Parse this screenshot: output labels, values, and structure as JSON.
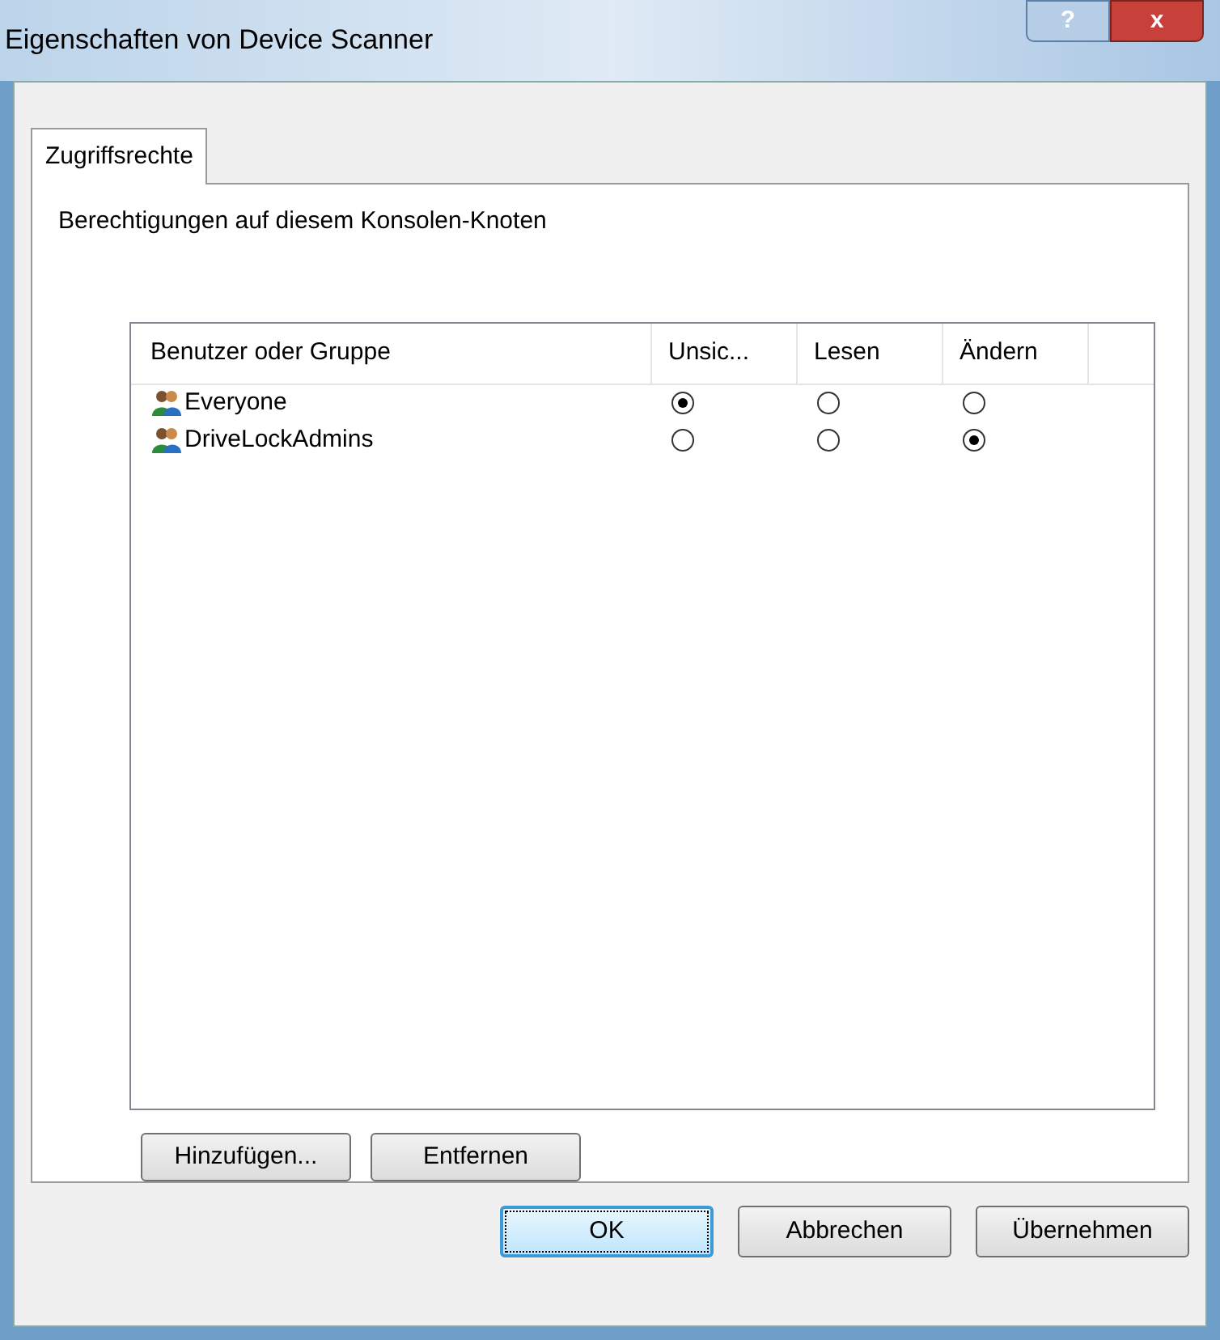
{
  "window": {
    "title": "Eigenschaften von Device Scanner",
    "help": "?",
    "close": "x"
  },
  "tabs": [
    {
      "label": "Zugriffsrechte",
      "selected": true
    }
  ],
  "description": "Berechtigungen auf diesem Konsolen-Knoten",
  "table": {
    "columns": [
      "Benutzer oder Gruppe",
      "Unsic...",
      "Lesen",
      "Ändern"
    ],
    "rows": [
      {
        "name": "Everyone",
        "options": [
          {
            "selected": true
          },
          {
            "selected": false
          },
          {
            "selected": false
          }
        ]
      },
      {
        "name": "DriveLockAdmins",
        "options": [
          {
            "selected": false
          },
          {
            "selected": false
          },
          {
            "selected": true
          }
        ]
      }
    ]
  },
  "list_buttons": [
    "Hinzufügen...",
    "Entfernen"
  ],
  "dialog_buttons": [
    {
      "label": "OK",
      "default": true
    },
    {
      "label": "Abbrechen",
      "default": false
    },
    {
      "label": "Übernehmen",
      "default": false
    }
  ]
}
